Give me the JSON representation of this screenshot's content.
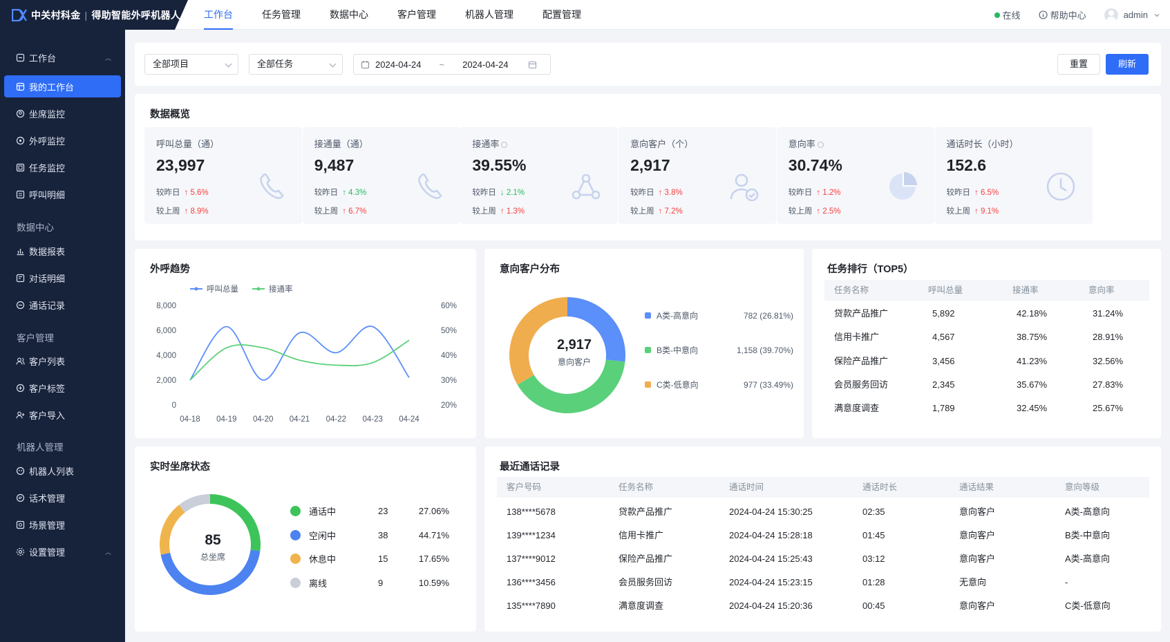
{
  "app": {
    "brand": "中关村科金",
    "product": "得助智能外呼机器人"
  },
  "topnav": [
    {
      "label": "工作台",
      "active": true
    },
    {
      "label": "任务管理"
    },
    {
      "label": "数据中心"
    },
    {
      "label": "客户管理"
    },
    {
      "label": "机器人管理"
    },
    {
      "label": "配置管理"
    }
  ],
  "topright": {
    "status": "在线",
    "help": "帮助中心",
    "user": "admin"
  },
  "sidebar": {
    "workbench": "工作台",
    "my_workbench": "我的工作台",
    "seat_monitor": "坐席监控",
    "outbound_monitor": "外呼监控",
    "task_monitor": "任务监控",
    "call_detail": "呼叫明细",
    "data_center": "数据中心",
    "data_report": "数据报表",
    "dialog_detail": "对话明细",
    "call_record": "通话记录",
    "customer_mgmt": "客户管理",
    "customer_list": "客户列表",
    "customer_tag": "客户标签",
    "customer_import": "客户导入",
    "robot_mgmt": "机器人管理",
    "robot_list": "机器人列表",
    "script_mgmt": "话术管理",
    "scene_mgmt": "场景管理",
    "settings": "设置管理"
  },
  "filters": {
    "project": "全部项目",
    "task": "全部任务",
    "date_start": "2024-04-24",
    "date_sep": "~",
    "date_end": "2024-04-24",
    "reset": "重置",
    "refresh": "刷新"
  },
  "overview": {
    "title": "数据概览",
    "day_label": "较昨日",
    "week_label": "较上周",
    "cards": [
      {
        "label": "呼叫总量（通）",
        "value": "23,997",
        "day": "↑ 5.6%",
        "day_dir": "up",
        "week": "↑ 8.9%",
        "week_dir": "up",
        "icon": "phone-icon"
      },
      {
        "label": "接通量（通）",
        "value": "9,487",
        "day": "↑ 4.3%",
        "day_dir": "down",
        "week": "↑ 6.7%",
        "week_dir": "up",
        "icon": "phone-icon"
      },
      {
        "label": "接通率",
        "value": "39.55%",
        "day": "↓ 2.1%",
        "day_dir": "down",
        "week": "↑ 1.3%",
        "week_dir": "up",
        "icon": "share-icon",
        "info": true
      },
      {
        "label": "意向客户（个）",
        "value": "2,917",
        "day": "↑ 3.8%",
        "day_dir": "up",
        "week": "↑ 7.2%",
        "week_dir": "up",
        "icon": "user-check-icon"
      },
      {
        "label": "意向率",
        "value": "30.74%",
        "day": "↑ 1.2%",
        "day_dir": "up",
        "week": "↑ 2.5%",
        "week_dir": "up",
        "icon": "pie-icon",
        "info": true
      },
      {
        "label": "通话时长（小时）",
        "value": "152.6",
        "day": "↑ 6.5%",
        "day_dir": "up",
        "week": "↑ 9.1%",
        "week_dir": "up",
        "icon": "clock-icon"
      }
    ]
  },
  "colors": {
    "blue": "#5b8ff9",
    "green": "#5ad07a",
    "orange": "#f0ad4e",
    "gray": "#c9ced8",
    "up": "#f53f3f",
    "down": "#25b864",
    "accent": "#2f6df6"
  },
  "trend": {
    "title": "外呼趋势"
  },
  "intent": {
    "title": "意向客户分布",
    "center_value": "2,917",
    "center_label": "意向客户"
  },
  "ranking": {
    "title": "任务排行（TOP5）",
    "headers": [
      "任务名称",
      "呼叫总量",
      "接通率",
      "意向率"
    ],
    "rows": [
      [
        "贷款产品推广",
        "5,892",
        "42.18%",
        "31.24%"
      ],
      [
        "信用卡推广",
        "4,567",
        "38.75%",
        "28.91%"
      ],
      [
        "保险产品推广",
        "3,456",
        "41.23%",
        "32.56%"
      ],
      [
        "会员服务回访",
        "2,345",
        "35.67%",
        "27.83%"
      ],
      [
        "满意度调查",
        "1,789",
        "32.45%",
        "25.67%"
      ]
    ]
  },
  "seats": {
    "title": "实时坐席状态",
    "center_value": "85",
    "center_label": "总坐席"
  },
  "calls": {
    "title": "最近通话记录",
    "headers": [
      "客户号码",
      "任务名称",
      "通话时间",
      "通话时长",
      "通话结果",
      "意向等级"
    ],
    "rows": [
      [
        "138****5678",
        "贷款产品推广",
        "2024-04-24 15:30:25",
        "02:35",
        "意向客户",
        "A类-高意向"
      ],
      [
        "139****1234",
        "信用卡推广",
        "2024-04-24 15:28:18",
        "01:45",
        "意向客户",
        "B类-中意向"
      ],
      [
        "137****9012",
        "保险产品推广",
        "2024-04-24 15:25:43",
        "03:12",
        "意向客户",
        "A类-高意向"
      ],
      [
        "136****3456",
        "会员服务回访",
        "2024-04-24 15:23:15",
        "01:28",
        "无意向",
        "-"
      ],
      [
        "135****7890",
        "满意度调查",
        "2024-04-24 15:20:36",
        "00:45",
        "意向客户",
        "C类-低意向"
      ]
    ]
  },
  "chart_data": [
    {
      "type": "line",
      "title": "外呼趋势",
      "x": [
        "04-18",
        "04-19",
        "04-20",
        "04-21",
        "04-22",
        "04-23",
        "04-24"
      ],
      "series": [
        {
          "name": "呼叫总量",
          "axis": "left",
          "color": "#5b8ff9",
          "values": [
            2000,
            6300,
            2000,
            5800,
            4200,
            6300,
            2200
          ]
        },
        {
          "name": "接通率",
          "axis": "right",
          "color": "#5ad07a",
          "values": [
            30,
            43,
            43,
            38,
            36,
            37,
            46
          ]
        }
      ],
      "y_left": {
        "ticks": [
          "8,000",
          "6,000",
          "4,000",
          "2,000",
          "0"
        ],
        "lim": [
          0,
          8000
        ]
      },
      "y_right": {
        "ticks": [
          "60%",
          "50%",
          "40%",
          "30%",
          "20%"
        ],
        "lim": [
          20,
          60
        ]
      },
      "legend": "top"
    },
    {
      "type": "pie",
      "title": "意向客户分布",
      "slices": [
        {
          "name": "A类-高意向",
          "value": 782,
          "label": "782 (26.81%)",
          "color": "#5b8ff9"
        },
        {
          "name": "B类-中意向",
          "value": 1158,
          "label": "1,158 (39.70%)",
          "color": "#5ad07a"
        },
        {
          "name": "C类-低意向",
          "value": 977,
          "label": "977 (33.49%)",
          "color": "#f0ad4e"
        }
      ]
    },
    {
      "type": "pie",
      "title": "实时坐席状态",
      "slices": [
        {
          "name": "通话中",
          "value": 23,
          "label": "27.06%",
          "color": "#3cc45a"
        },
        {
          "name": "空闲中",
          "value": 38,
          "label": "44.71%",
          "color": "#4c83f0"
        },
        {
          "name": "休息中",
          "value": 15,
          "label": "17.65%",
          "color": "#f0b44c"
        },
        {
          "name": "离线",
          "value": 9,
          "label": "10.59%",
          "color": "#c9ced8"
        }
      ]
    }
  ]
}
